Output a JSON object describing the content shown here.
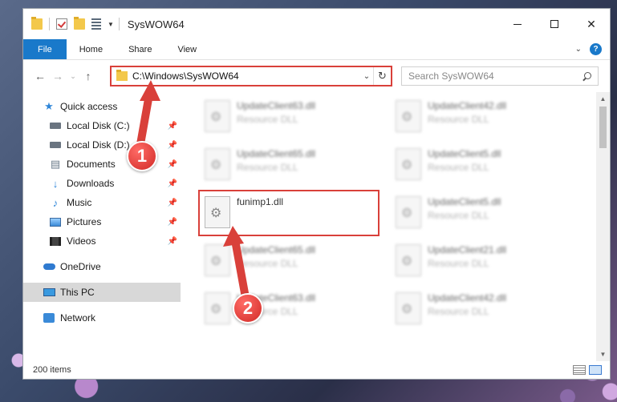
{
  "window": {
    "title": "SysWOW64",
    "controls": {
      "minimize": "—",
      "maximize": "☐",
      "close": "✕"
    }
  },
  "ribbon": {
    "tabs": [
      "File",
      "Home",
      "Share",
      "View"
    ]
  },
  "navigation": {
    "back": "←",
    "forward": "→",
    "recent": "⌄",
    "up": "↑",
    "address": "C:\\Windows\\SysWOW64",
    "search_placeholder": "Search SysWOW64"
  },
  "sidebar": {
    "quick_access": "Quick access",
    "pinned": [
      {
        "label": "Local Disk (C:)",
        "icon": "drive-icon"
      },
      {
        "label": "Local Disk (D:)",
        "icon": "drive-icon"
      },
      {
        "label": "Documents",
        "icon": "documents-icon"
      },
      {
        "label": "Downloads",
        "icon": "download-icon"
      },
      {
        "label": "Music",
        "icon": "music-icon"
      },
      {
        "label": "Pictures",
        "icon": "pictures-icon"
      },
      {
        "label": "Videos",
        "icon": "videos-icon"
      }
    ],
    "onedrive": "OneDrive",
    "this_pc": "This PC",
    "network": "Network"
  },
  "files": [
    {
      "name": "UpdateClient63.dll",
      "type": "Resource DLL",
      "blurred": true
    },
    {
      "name": "UpdateClient42.dll",
      "type": "Resource DLL",
      "blurred": true
    },
    {
      "name": "UpdateClient65.dll",
      "type": "Resource DLL",
      "blurred": true
    },
    {
      "name": "UpdateClient5.dll",
      "type": "Resource DLL",
      "blurred": true
    },
    {
      "name": "funimp1.dll",
      "type": "",
      "blurred": false
    },
    {
      "name": "UpdateClient5.dll",
      "type": "Resource DLL",
      "blurred": true
    },
    {
      "name": "UpdateClient65.dll",
      "type": "Resource DLL",
      "blurred": true
    },
    {
      "name": "UpdateClient21.dll",
      "type": "Resource DLL",
      "blurred": true
    },
    {
      "name": "UpdateClient63.dll",
      "type": "Resource DLL",
      "blurred": true
    },
    {
      "name": "UpdateClient42.dll",
      "type": "Resource DLL",
      "blurred": true
    }
  ],
  "status": {
    "item_count": "200 items"
  },
  "annotations": {
    "step1": "1",
    "step2": "2",
    "highlight_color": "#d9403a"
  }
}
